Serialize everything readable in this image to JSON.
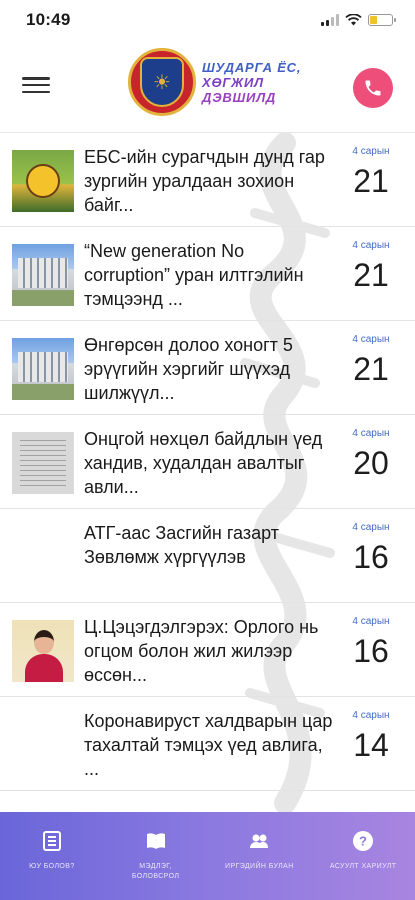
{
  "status_bar": {
    "time": "10:49"
  },
  "header": {
    "logo_lines": [
      "ШУДАРГА ЁС,",
      "ХӨГЖИЛ",
      "ДЭВШИЛД"
    ],
    "menu_icon": "hamburger-menu-icon",
    "call_icon": "phone-icon",
    "call_color": "#ee4e7a"
  },
  "news": [
    {
      "title": "ЕБС-ийн сурагчдын дунд гар зургийн уралдаан зохион байг...",
      "month": "4 сарын",
      "day": "21",
      "thumb": "school-drawing"
    },
    {
      "title": "“New generation No corruption” уран илтгэлийн тэмцээнд ...",
      "month": "4 сарын",
      "day": "21",
      "thumb": "building"
    },
    {
      "title": "Өнгөрсөн долоо хоногт 5 эрүүгийн хэргийг шүүхэд шилжүүл...",
      "month": "4 сарын",
      "day": "21",
      "thumb": "building"
    },
    {
      "title": "Онцгой нөхцөл байдлын үед хандив, худалдан авалтыг авли...",
      "month": "4 сарын",
      "day": "20",
      "thumb": "document"
    },
    {
      "title": "АТГ-аас Засгийн газарт Зөвлөмж хүргүүлэв",
      "month": "4 сарын",
      "day": "16",
      "thumb": "none"
    },
    {
      "title": "Ц.Цэцэгдэлгэрэх: Орлого нь огцом болон жил жилээр өссөн...",
      "month": "4 сарын",
      "day": "16",
      "thumb": "person"
    },
    {
      "title": "Коронавируст халдварын цар тахалтай тэмцэх үед авлига, ...",
      "month": "4 сарын",
      "day": "14",
      "thumb": "none"
    }
  ],
  "bottom_nav": [
    {
      "label": "ЮУ БОЛОВ?",
      "icon": "news-list-icon"
    },
    {
      "label": "МЭДЛЭГ, БОЛОВСРОЛ",
      "icon": "book-icon"
    },
    {
      "label": "ИРГЭДИЙН БУЛАН",
      "icon": "people-icon"
    },
    {
      "label": "АСУУЛТ ХАРИУЛТ",
      "icon": "question-icon"
    }
  ],
  "colors": {
    "accent_blue": "#3f6bc7",
    "nav_gradient_start": "#6a66d9",
    "nav_gradient_end": "#a885e0"
  }
}
